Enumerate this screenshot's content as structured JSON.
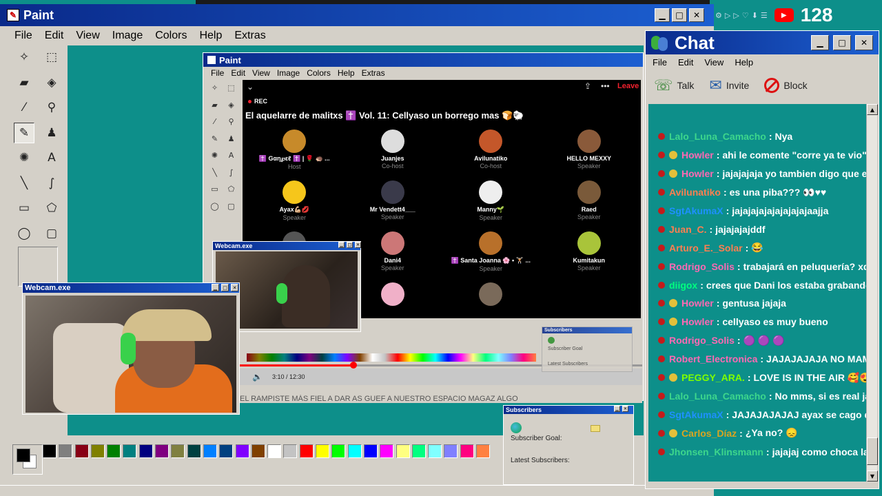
{
  "paint": {
    "title": "Paint",
    "menu": [
      "File",
      "Edit",
      "View",
      "Image",
      "Colors",
      "Help",
      "Extras"
    ],
    "tools": [
      {
        "icon": "free-select-icon",
        "glyph": "✧"
      },
      {
        "icon": "rect-select-icon",
        "glyph": "⬚"
      },
      {
        "icon": "eraser-icon",
        "glyph": "▰"
      },
      {
        "icon": "fill-icon",
        "glyph": "◈"
      },
      {
        "icon": "color-picker-icon",
        "glyph": "⁄"
      },
      {
        "icon": "magnifier-icon",
        "glyph": "⚲"
      },
      {
        "icon": "pencil-icon",
        "glyph": "✎"
      },
      {
        "icon": "brush-icon",
        "glyph": "♟"
      },
      {
        "icon": "airbrush-icon",
        "glyph": "✺"
      },
      {
        "icon": "text-icon",
        "glyph": "A"
      },
      {
        "icon": "line-icon",
        "glyph": "╲"
      },
      {
        "icon": "curve-icon",
        "glyph": "∫"
      },
      {
        "icon": "rectangle-icon",
        "glyph": "▭"
      },
      {
        "icon": "polygon-icon",
        "glyph": "⬠"
      },
      {
        "icon": "ellipse-icon",
        "glyph": "◯"
      },
      {
        "icon": "rounded-rect-icon",
        "glyph": "▢"
      }
    ],
    "palette": [
      "#000000",
      "#7f7f7f",
      "#880015",
      "#808000",
      "#008000",
      "#008080",
      "#000080",
      "#800080",
      "#808040",
      "#004040",
      "#0080ff",
      "#004080",
      "#8000ff",
      "#804000",
      "#ffffff",
      "#c3c3c3",
      "#ff0000",
      "#ffff00",
      "#00ff00",
      "#00ffff",
      "#0000ff",
      "#ff00ff",
      "#ffff80",
      "#00ff80",
      "#80ffff",
      "#8080ff",
      "#ff0080",
      "#ff8040"
    ]
  },
  "inner_paint": {
    "title": "Paint",
    "menu": [
      "File",
      "Edit",
      "View",
      "Image",
      "Colors",
      "Help",
      "Extras"
    ]
  },
  "space": {
    "rec": "REC",
    "leave": "Leave",
    "title": "El aquelarre de malitxs ✝️ Vol. 11: Cellyaso un borrego mas 🍞🐑",
    "participants": [
      {
        "name": "✝️ Gαη℘εℓ ✝️ | 🌹 🦔 ...",
        "role": "Host",
        "color": "#c78a2a"
      },
      {
        "name": "Juanjes",
        "role": "Co-host",
        "color": "#ddd"
      },
      {
        "name": "Avilunatiko",
        "role": "Co-host",
        "color": "#c4572a"
      },
      {
        "name": "HELLO MEXXY",
        "role": "Speaker",
        "color": "#8a5a3a"
      },
      {
        "name": "Ayax💪🏼💋",
        "role": "Speaker",
        "color": "#f6c61b"
      },
      {
        "name": "Mr Vendett4___",
        "role": "Speaker",
        "color": "#3a3a4a"
      },
      {
        "name": "Manny🌱",
        "role": "Speaker",
        "color": "#eeeeee"
      },
      {
        "name": "Raed",
        "role": "Speaker",
        "color": "#7a5a3a"
      },
      {
        "name": "",
        "role": "",
        "color": "#555"
      },
      {
        "name": "Dani4",
        "role": "Speaker",
        "color": "#c77"
      },
      {
        "name": "✝️ Santa Joanna 🌸 • 🏋🏻 ...",
        "role": "Speaker",
        "color": "#b8702a"
      },
      {
        "name": "Kumitakun",
        "role": "Speaker",
        "color": "#a9c43a"
      },
      {
        "name": "",
        "role": "",
        "color": "#000"
      },
      {
        "name": "",
        "role": "",
        "color": "#f0b0c8"
      },
      {
        "name": "",
        "role": "",
        "color": "#7a6a5a"
      },
      {
        "name": "",
        "role": "",
        "color": "#000"
      }
    ]
  },
  "player": {
    "time": "3:10 / 12:30"
  },
  "ticker": "EL RAMPISTE MÁS FIEL A DAR AS GUEF A NUESTRO ESPACIO MAGAZ ALGO",
  "webcam_small": {
    "title": "Webcam.exe"
  },
  "webcam_large": {
    "title": "Webcam.exe"
  },
  "subscribers_small": {
    "title": "Subscribers",
    "goal": "Subscriber Goal",
    "latest": "Latest Subscribers"
  },
  "subscribers": {
    "title": "Subscribers",
    "goal": "Subscriber Goal:",
    "latest": "Latest Subscribers:"
  },
  "yt_counter": "128",
  "chat": {
    "title": "Chat",
    "menu": [
      "File",
      "Edit",
      "View",
      "Help"
    ],
    "toolbar": [
      {
        "label": "Talk",
        "icon": "talk-icon"
      },
      {
        "label": "Invite",
        "icon": "invite-icon"
      },
      {
        "label": "Block",
        "icon": "block-icon"
      }
    ],
    "messages": [
      {
        "user": "Lalo_Luna_Camacho",
        "color": "#3dd68c",
        "badge": "dot",
        "text": "Nya"
      },
      {
        "user": "Howler",
        "color": "#ff69b4",
        "badge": "bulb",
        "text": "ahi le comente \"corre ya te vio\""
      },
      {
        "user": "Howler",
        "color": "#ff69b4",
        "badge": "bulb",
        "text": "jajajajaja yo tambien digo que el truco"
      },
      {
        "user": "Avilunatiko",
        "color": "#ff7f50",
        "badge": "dot",
        "text": "es una piba??? 👀♥♥"
      },
      {
        "user": "SgtAkumaX",
        "color": "#1e90ff",
        "badge": "dot",
        "text": "jajajajajajajajajajaajja"
      },
      {
        "user": "Juan_C.",
        "color": "#ff7f50",
        "badge": "dot",
        "text": "jajajajajddf"
      },
      {
        "user": "Arturo_E._Solar",
        "color": "#ff7f50",
        "badge": "dot",
        "text": "😂"
      },
      {
        "user": "Rodrigo_Solis",
        "color": "#ff69b4",
        "badge": "dot",
        "text": "trabajará en peluquería? xdd"
      },
      {
        "user": "diigox",
        "color": "#00ff7f",
        "badge": "dot",
        "text": "crees que Dani los estaba grabando? el"
      },
      {
        "user": "Howler",
        "color": "#ff69b4",
        "badge": "bulb",
        "text": "gentusa jajaja"
      },
      {
        "user": "Howler",
        "color": "#ff69b4",
        "badge": "bulb",
        "text": "cellyaso es muy bueno"
      },
      {
        "user": "Rodrigo_Solis",
        "color": "#ff69b4",
        "badge": "dot",
        "text": "🟣 🟣 🟣"
      },
      {
        "user": "Robert_Electronica",
        "color": "#ff69b4",
        "badge": "dot",
        "text": "JAJAJAJAJA NO MAMEN"
      },
      {
        "user": "PEGGY_ARA.",
        "color": "#7fff00",
        "badge": "bulb",
        "text": "LOVE IS IN THE AIR 🥰😍😍"
      },
      {
        "user": "Lalo_Luna_Camacho",
        "color": "#3dd68c",
        "badge": "dot",
        "text": "No mms, si es real jaja"
      },
      {
        "user": "SgtAkumaX",
        "color": "#1e90ff",
        "badge": "dot",
        "text": "JAJAJAJAJAJ ayax se cago de"
      },
      {
        "user": "Carlos_Díaz",
        "color": "#daa520",
        "badge": "bulb",
        "text": "¿Ya no? 😞"
      },
      {
        "user": "Jhonsen_Klinsmann",
        "color": "#3dd68c",
        "badge": "dot",
        "text": "jajajaj como choca la leng"
      }
    ]
  }
}
